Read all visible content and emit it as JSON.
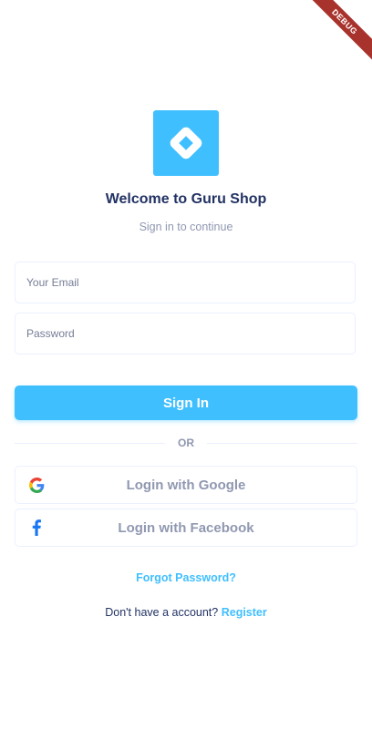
{
  "debug_banner": "DEBUG",
  "header": {
    "title": "Welcome to Guru Shop",
    "subtitle": "Sign in to continue"
  },
  "form": {
    "email_placeholder": "Your Email",
    "password_placeholder": "Password",
    "signin_label": "Sign In"
  },
  "divider": {
    "label": "OR"
  },
  "social": {
    "google_label": "Login with Google",
    "facebook_label": "Login with Facebook",
    "google_icon": "google-icon",
    "facebook_icon": "facebook-icon"
  },
  "footer": {
    "forgot_label": "Forgot Password?",
    "no_account_text": "Don't have a account?",
    "register_label": "Register"
  },
  "colors": {
    "primary": "#40bfff",
    "title": "#223263",
    "muted": "#9098b1",
    "border": "#ebf0ff",
    "debug_ribbon": "#a8332d"
  }
}
